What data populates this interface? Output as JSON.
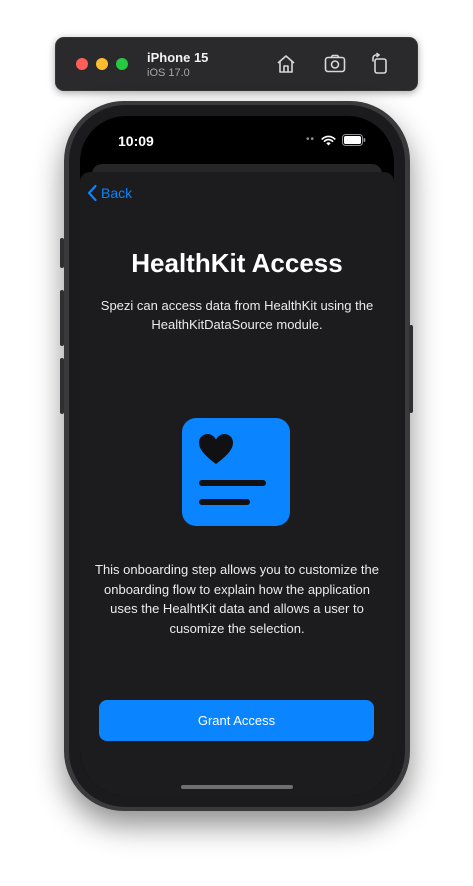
{
  "simulator": {
    "device_name": "iPhone 15",
    "os_version": "iOS 17.0",
    "traffic_lights": {
      "close": "#ff5f57",
      "minimize": "#febc2e",
      "zoom": "#28c840"
    },
    "toolbar_icons": [
      "home-icon",
      "screenshot-icon",
      "rotate-icon"
    ]
  },
  "status_bar": {
    "time": "10:09",
    "icons": [
      "wifi-icon",
      "battery-icon"
    ]
  },
  "nav": {
    "back_label": "Back"
  },
  "content": {
    "title": "HealthKit Access",
    "subtitle": "Spezi can access data from HealthKit using the HealthKitDataSource module.",
    "icon": "healthkit-heart-document-icon",
    "body": "This onboarding step allows you to customize the onboarding flow to explain how the application uses the HealhtKit data and allows a user to cusomize the selection.",
    "primary_button_label": "Grant Access"
  },
  "colors": {
    "accent": "#0a84ff",
    "background": "#1c1c1e",
    "text": "#ffffff"
  }
}
